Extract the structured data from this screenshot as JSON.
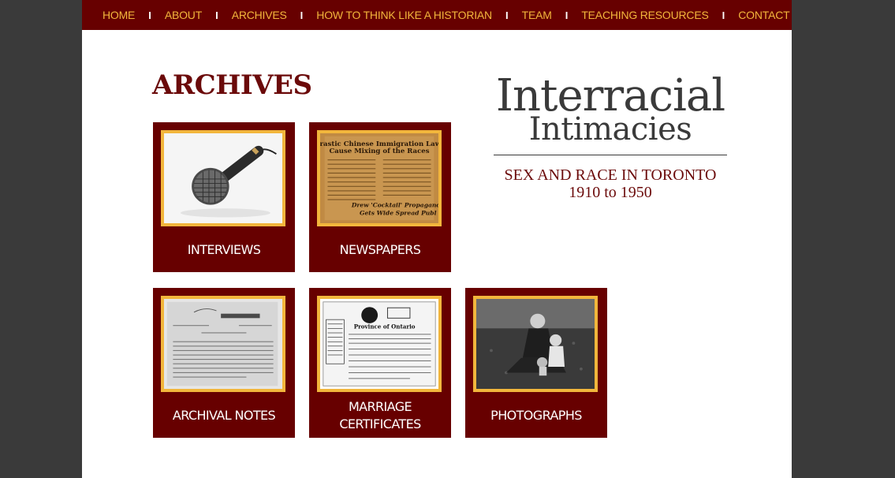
{
  "nav": {
    "items": [
      {
        "label": "HOME"
      },
      {
        "label": "ABOUT"
      },
      {
        "label": "ARCHIVES"
      },
      {
        "label": "HOW TO THINK LIKE A HISTORIAN"
      },
      {
        "label": "TEAM"
      },
      {
        "label": "TEACHING RESOURCES"
      },
      {
        "label": "CONTACT"
      }
    ],
    "separator": "I"
  },
  "page_title": "ARCHIVES",
  "brand": {
    "line1": "Interracial",
    "line2": "Intimacies",
    "subtitle1": "SEX AND RACE IN TORONTO",
    "subtitle2": "1910 to 1950"
  },
  "tiles": [
    {
      "label": "INTERVIEWS",
      "icon": "microphone-photo"
    },
    {
      "label": "NEWSPAPERS",
      "icon": "newspaper-clipping-photo"
    },
    {
      "label": "ARCHIVAL NOTES",
      "icon": "archival-document-photo"
    },
    {
      "label": "MARRIAGE CERTIFICATES",
      "icon": "marriage-certificate-photo"
    },
    {
      "label": "PHOTOGRAPHS",
      "icon": "family-photograph"
    }
  ],
  "newspaper_headline": {
    "line1": "Drastic Chinese Immigration Laws",
    "line2": "Cause Mixing of the Races",
    "footer1": "Drew 'Cocktail' Propaganda",
    "footer2": "Gets Wide Spread Publ"
  },
  "certificate_heading": "Province of Ontario",
  "colors": {
    "maroon": "#670000",
    "gold": "#f2b63c",
    "title_red": "#6b0a0a",
    "brand_gray": "#3a3a3a"
  }
}
